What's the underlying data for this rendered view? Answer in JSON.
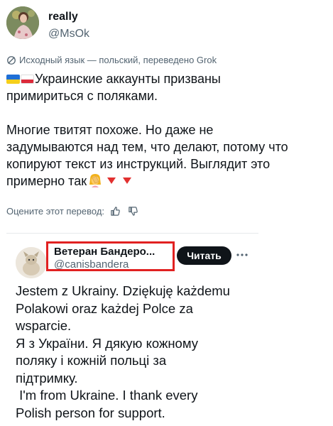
{
  "tweet": {
    "author_name": "really",
    "author_handle": "@MsOk",
    "translation_note": "Исходный язык — польский, переведено Grok",
    "paragraph1_line1": "Украинские аккаунты призваны",
    "paragraph1_line2": "примириться с поляками.",
    "paragraph2_lines": [
      "Многие твитят похоже. Но даже не",
      "задумываются над тем, что делают, потому что",
      "копируют текст из инструкций. Выглядит это",
      "примерно так"
    ],
    "rate_label": "Оцените этот перевод:",
    "icons": [
      "grok-icon",
      "thumbs-up-icon",
      "thumbs-down-icon",
      "flag-ukraine-icon",
      "flag-poland-icon",
      "facepalm-emoji-icon",
      "red-triangle-down-icon"
    ]
  },
  "quoted": {
    "author_name": "Ветеран Бандеро...",
    "author_handle": "@canisbandera",
    "follow_label": "Читать",
    "lines": [
      "Jestem z Ukrainy. Dziękuję każdemu",
      "Polakowi oraz każdej Polce za",
      "wsparcie.",
      "Я з України. Я дякую кожному",
      "поляку і кожній польці за",
      "підтримку.",
      " I'm from Ukraine. I thank every",
      "Polish person for support."
    ]
  },
  "colors": {
    "text": "#0f1419",
    "secondary": "#536471",
    "highlight_border": "#e12121",
    "follow_bg": "#0f1419"
  }
}
